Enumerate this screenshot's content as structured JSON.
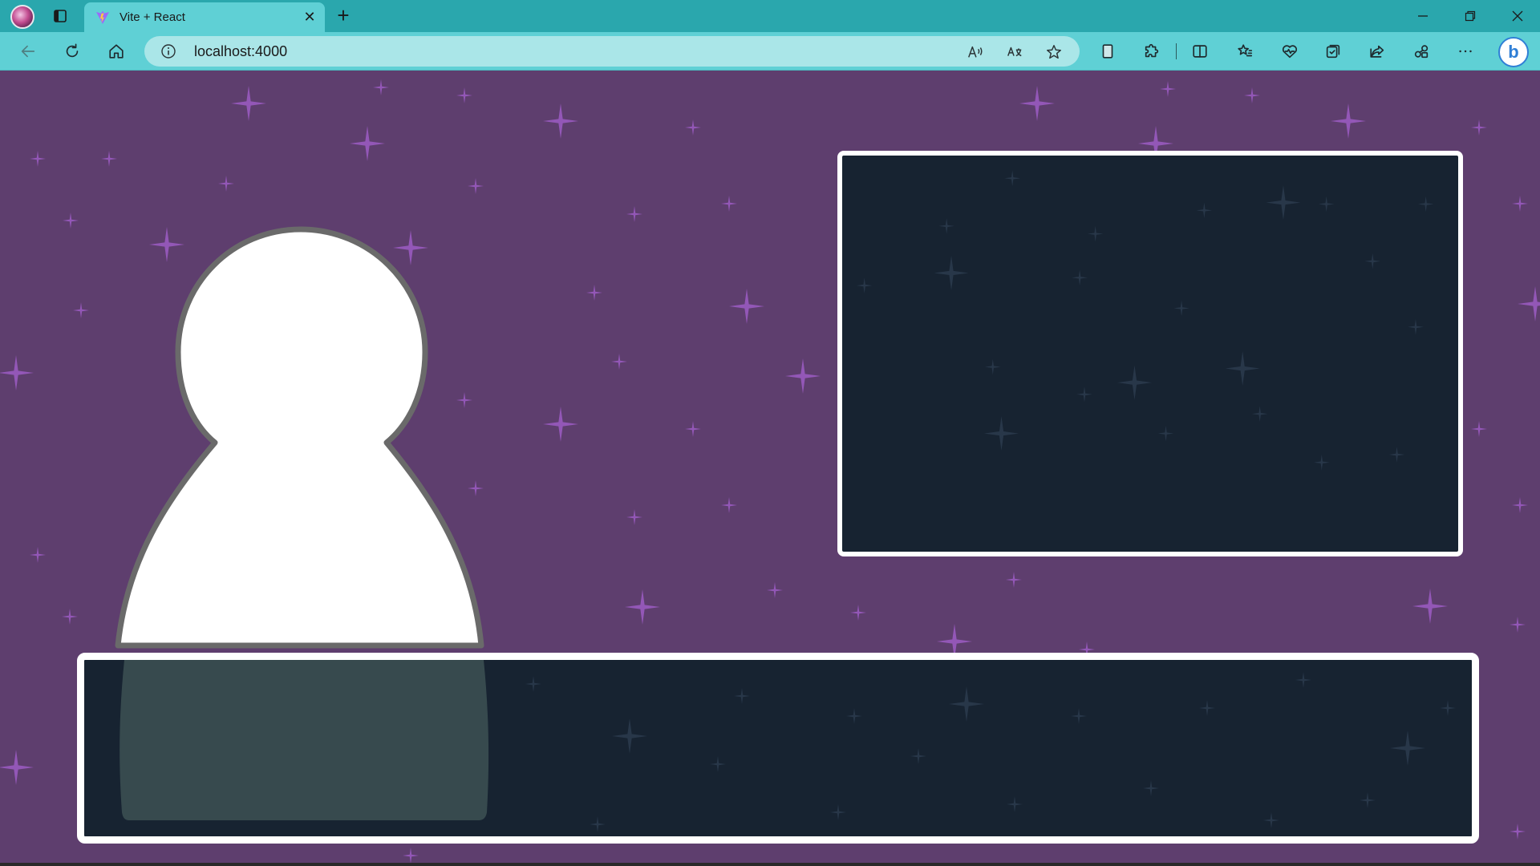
{
  "browser": {
    "tab_title": "Vite + React",
    "address": "localhost:4000",
    "icons": {
      "profile": "profile-avatar-icon",
      "tabs": "tab-actions-icon",
      "favicon": "vite-favicon-icon",
      "close_tab": "close-icon",
      "new_tab": "plus-icon",
      "minimize": "minimize-icon",
      "restore": "restore-icon",
      "close_window": "close-icon",
      "back": "back-arrow-icon",
      "refresh": "refresh-icon",
      "home": "home-icon",
      "site_info": "info-icon",
      "read_aloud": "read-aloud-icon",
      "translate": "translate-icon",
      "favorite": "star-icon",
      "split": "split-screen-icon",
      "favorites": "favorites-icon",
      "health": "browser-essentials-icon",
      "collections": "collections-icon",
      "share": "share-icon",
      "extensions": "extensions-icon",
      "more": "more-icon",
      "copilot": "bing-icon"
    },
    "colors": {
      "titlebar": "#2aa7ad",
      "toolbar": "#5fd0d5",
      "address_bar": "#aae6e8"
    }
  },
  "scene": {
    "background_color": "#5e3e6e",
    "star_color": "#9c5cc4",
    "panel_fill": "#172331",
    "panel_border": "#ffffff",
    "character_fill": "#ffffff",
    "character_outline": "#6a6a6a"
  }
}
